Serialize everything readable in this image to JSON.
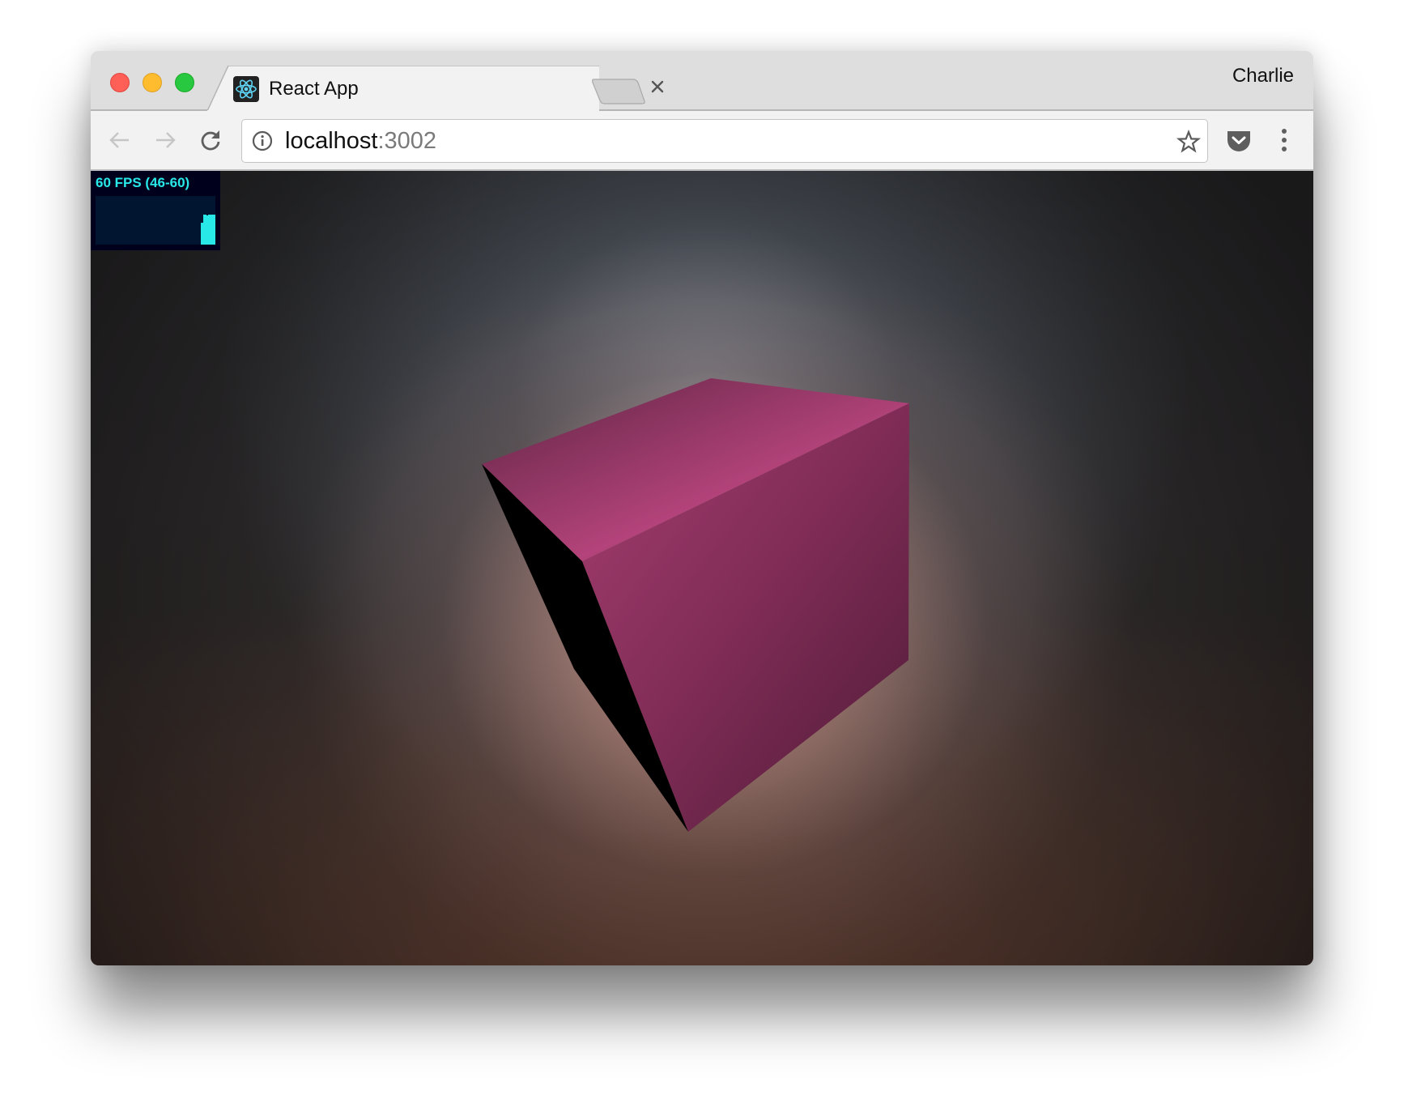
{
  "browser": {
    "tab": {
      "title": "React App",
      "favicon": "react-logo-icon",
      "close": "close-icon"
    },
    "profile_name": "Charlie",
    "toolbar": {
      "back": "arrow-left-icon",
      "forward": "arrow-right-icon",
      "reload": "reload-icon",
      "site_info": "info-icon",
      "bookmark": "star-icon",
      "extension": "pocket-icon",
      "menu": "more-vertical-icon"
    },
    "address": {
      "host": "localhost",
      "port": ":3002"
    }
  },
  "page": {
    "fps_meter": {
      "label": "60 FPS (46-60)",
      "current_fps": 60,
      "min_fps": 46,
      "max_fps": 60,
      "color": "#29e8e8"
    },
    "scene": {
      "object": "cube",
      "cube_color": "#b3437a",
      "background_top": "#2b2e32",
      "background_glow": "#c38e80"
    }
  }
}
